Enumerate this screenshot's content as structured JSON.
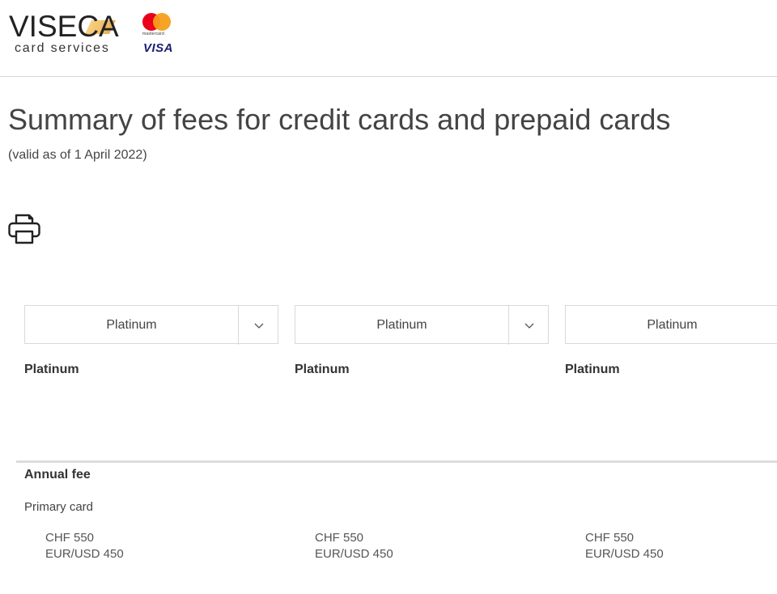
{
  "header": {
    "brand_name": "VISECA",
    "brand_sub": "card services",
    "mastercard_label": "mastercard",
    "visa_label": "VISA",
    "colors": {
      "mastercard_red": "#eb001b",
      "mastercard_yellow": "#f79e1b",
      "visa_blue": "#1a1f71"
    }
  },
  "main": {
    "title": "Summary of fees for credit cards and prepaid cards",
    "subtitle": "(valid as of 1 April 2022)",
    "print_icon": "printer-icon"
  },
  "columns": [
    {
      "select_value": "Platinum",
      "card_name": "Platinum",
      "values": [
        "CHF 550",
        "EUR/USD 450"
      ]
    },
    {
      "select_value": "Platinum",
      "card_name": "Platinum",
      "values": [
        "CHF 550",
        "EUR/USD 450"
      ]
    },
    {
      "select_value": "Platinum",
      "card_name": "Platinum",
      "values": [
        "CHF 550",
        "EUR/USD 450"
      ]
    }
  ],
  "fees": {
    "section_title": "Annual fee",
    "row_label": "Primary card"
  }
}
